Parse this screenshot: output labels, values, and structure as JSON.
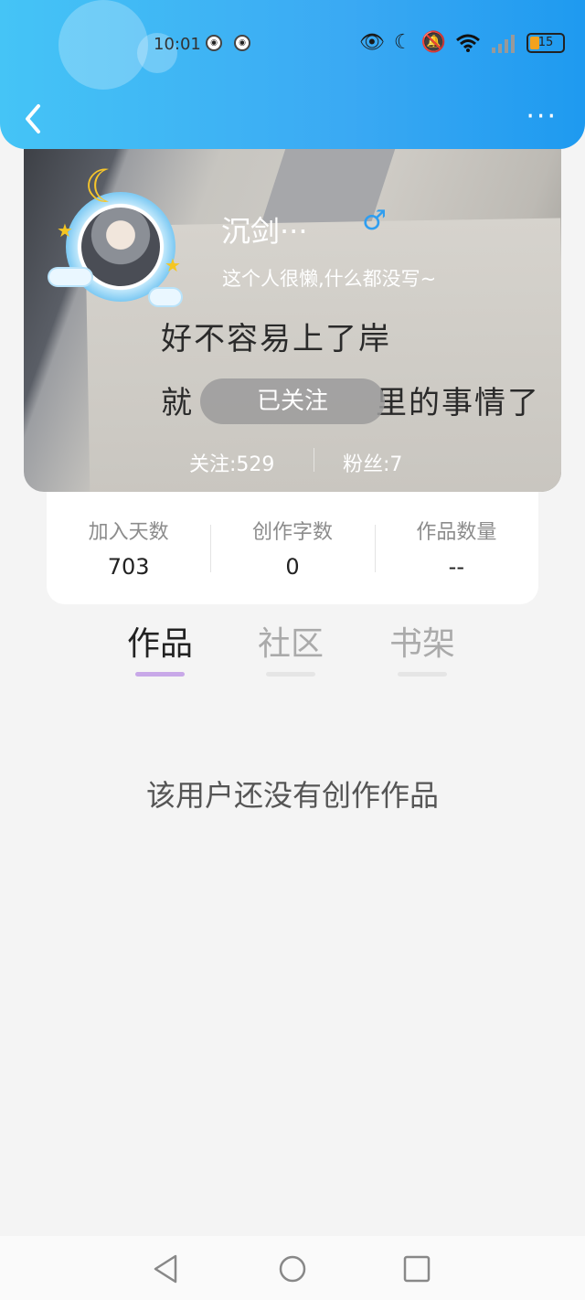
{
  "status_bar": {
    "time": "10:01",
    "battery": "15",
    "icons": [
      "eye-icon",
      "moon-icon",
      "mute-icon",
      "wifi-icon",
      "signal-icon"
    ]
  },
  "header": {
    "back_icon": "chevron-left-icon",
    "more_label": "···"
  },
  "profile": {
    "username": "沉剑···",
    "gender_symbol": "♂",
    "bio": "这个人很懒,什么都没写~",
    "follow_button": "已关注",
    "following_label": "关注:529",
    "fans_label": "粉丝:7",
    "cover_text_line1": "好不容易上了岸",
    "cover_text_line2": "就",
    "cover_text_line3": "里的事情了"
  },
  "stats": [
    {
      "label": "加入天数",
      "value": "703"
    },
    {
      "label": "创作字数",
      "value": "0"
    },
    {
      "label": "作品数量",
      "value": "--"
    }
  ],
  "tabs": [
    {
      "label": "作品"
    },
    {
      "label": "社区"
    },
    {
      "label": "书架"
    }
  ],
  "active_tab": "作品",
  "empty_message": "该用户还没有创作作品",
  "colors": {
    "header_gradient_start": "#45c4f6",
    "header_gradient_end": "#1e9af0",
    "tab_underline_active": "#c8a8e8",
    "gender_color": "#2f9ef0",
    "battery_fill": "#f4a21d"
  }
}
